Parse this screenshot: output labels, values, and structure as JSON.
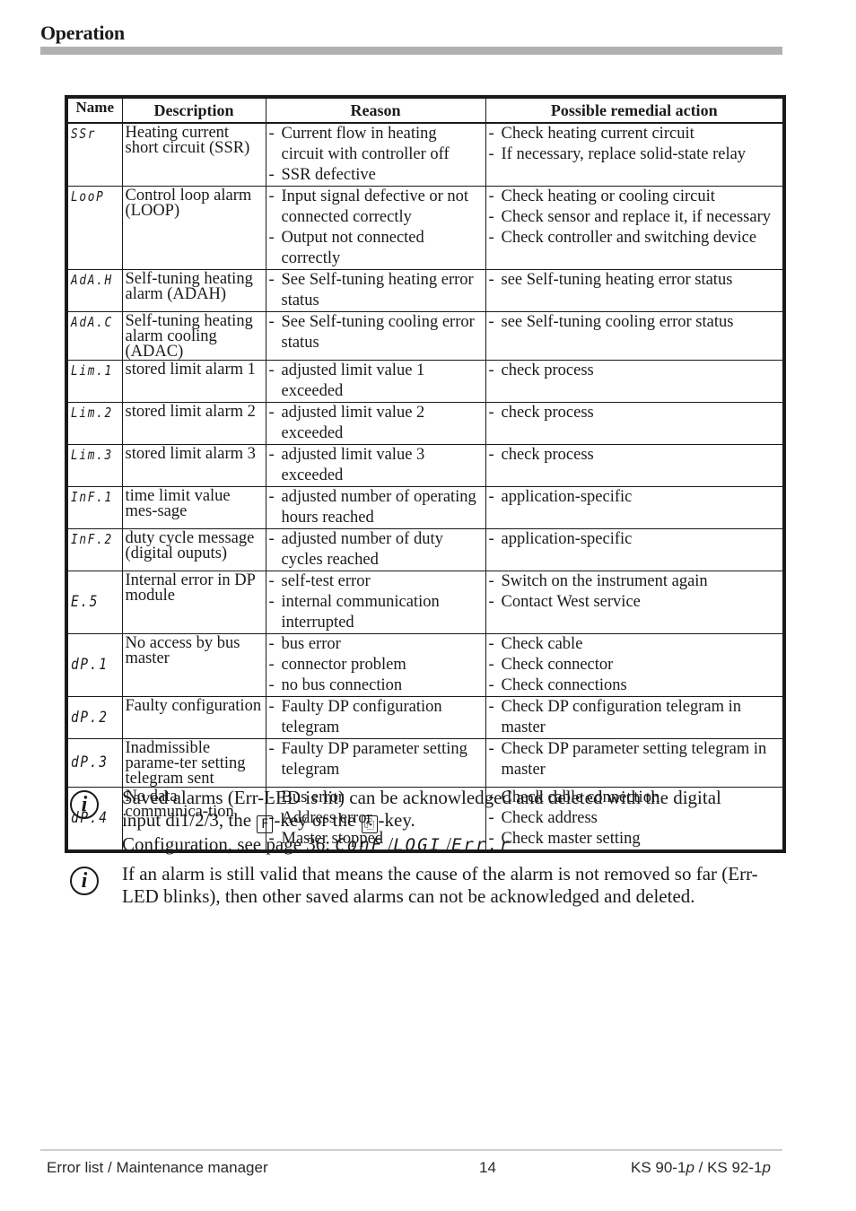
{
  "header": {
    "title": "Operation"
  },
  "table": {
    "columns": [
      "Name",
      "Description",
      "Reason",
      "Possible remedial action"
    ],
    "rows": [
      {
        "code": "SSr",
        "description": "Heating current short circuit (SSR)",
        "reasons": [
          "Current flow in heating circuit with controller off",
          "SSR defective"
        ],
        "actions": [
          "Check heating current circuit",
          "If necessary, replace solid-state relay"
        ]
      },
      {
        "code": "LooP",
        "description": "Control loop alarm (LOOP)",
        "reasons": [
          "Input signal defective or not connected correctly",
          "Output not connected correctly"
        ],
        "actions": [
          "Check heating or cooling circuit",
          "Check sensor and replace it, if necessary",
          "Check controller and switching device"
        ]
      },
      {
        "code": "AdA.H",
        "description": "Self-tuning heating alarm (ADAH)",
        "reasons": [
          "See Self-tuning heating error status"
        ],
        "actions": [
          "see Self-tuning heating error status"
        ]
      },
      {
        "code": "AdA.C",
        "description": "Self-tuning heating alarm cooling (ADAC)",
        "reasons": [
          "See  Self-tuning cooling error status"
        ],
        "actions": [
          "see Self-tuning cooling error status"
        ]
      },
      {
        "code": "Lim.1",
        "description": "stored limit alarm 1",
        "reasons": [
          "adjusted limit value 1 exceeded"
        ],
        "actions": [
          "check process"
        ]
      },
      {
        "code": "Lim.2",
        "description": "stored limit alarm 2",
        "reasons": [
          "adjusted limit value 2 exceeded"
        ],
        "actions": [
          "check process"
        ]
      },
      {
        "code": "Lim.3",
        "description": "stored limit alarm 3",
        "reasons": [
          "adjusted limit value 3 exceeded"
        ],
        "actions": [
          "check process"
        ]
      },
      {
        "code": "InF.1",
        "description": "time limit value mes-sage",
        "reasons": [
          "adjusted number of operating hours reached"
        ],
        "actions": [
          "application-specific"
        ]
      },
      {
        "code": "InF.2",
        "description": "duty cycle message (digital ouputs)",
        "reasons": [
          "adjusted number of duty cycles reached"
        ],
        "actions": [
          "application-specific"
        ]
      },
      {
        "code": "E.5",
        "description": "Internal error in DP module",
        "reasons": [
          "self-test error",
          "internal communication interrupted"
        ],
        "actions": [
          "Switch on the instrument again",
          "Contact West service"
        ]
      },
      {
        "code": "dP.1",
        "description": "No access by bus master",
        "reasons": [
          "bus error",
          "connector problem",
          "no bus connection"
        ],
        "actions": [
          "Check cable",
          "Check connector",
          "Check connections"
        ]
      },
      {
        "code": "dP.2",
        "description": "Faulty configuration",
        "reasons": [
          "Faulty  DP  configuration telegram"
        ],
        "actions": [
          "Check DP configuration telegram in master"
        ]
      },
      {
        "code": "dP.3",
        "description": "Inadmissible parame-ter setting telegram sent",
        "reasons": [
          "Faulty DP parameter setting telegram"
        ],
        "actions": [
          "Check DP parameter setting telegram in master"
        ]
      },
      {
        "code": "dP.4",
        "description": "No data communica-tion",
        "reasons": [
          "Bus error",
          "Address error",
          "Master stopped"
        ],
        "actions": [
          "Check cable connection",
          "Check address",
          "Check master setting"
        ]
      }
    ]
  },
  "notes": [
    {
      "icon": "info-icon",
      "line1": "Saved alarms (Err-LED is lit) can be acknowledged and deleted with the digital",
      "line2_pre": "input di1/2/3, the",
      "key1": "F",
      "line2_mid": "-key or the",
      "key2": "⎘",
      "line2_post": "-key.",
      "line3_pre": "Configuration, see page 36:",
      "path": [
        "ConF",
        "LOGI",
        "Err.r"
      ]
    },
    {
      "icon": "info-icon",
      "text": "If an alarm is still valid that means the cause of the alarm is not removed so far (Err-LED blinks), then other saved alarms can not be acknowledged and deleted."
    }
  ],
  "footer": {
    "section": "Error list / Maintenance manager",
    "page": "14",
    "product": "KS 90-1",
    "product_suffix": "p",
    "separator": " / ",
    "product2": "KS 92-1",
    "product2_suffix": "p"
  }
}
